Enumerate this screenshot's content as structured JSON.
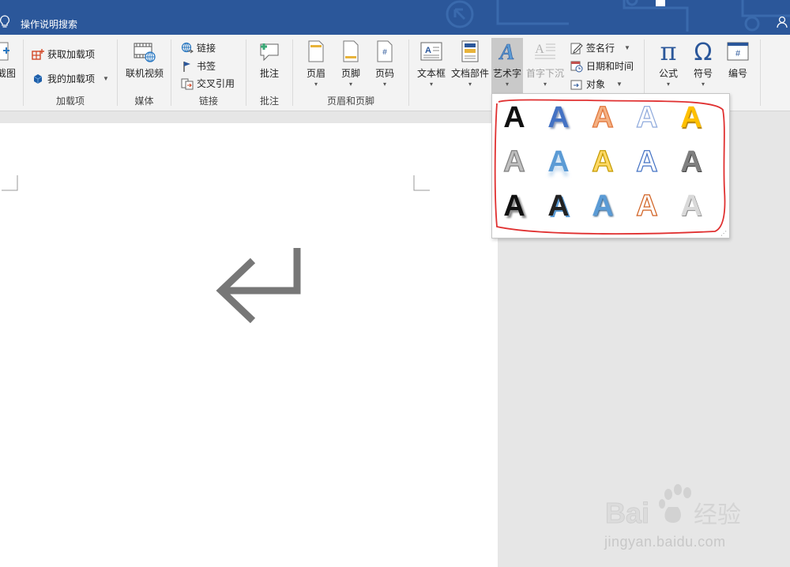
{
  "titlebar": {
    "search_label": "操作说明搜索",
    "accent_color": "#2b579a"
  },
  "ribbon": {
    "partial_screenshot_label": "截图",
    "addins": {
      "get_addins": "获取加载项",
      "my_addins": "我的加载项",
      "group_label": "加载项"
    },
    "media": {
      "online_video": "联机视频",
      "group_label": "媒体"
    },
    "links": {
      "link": "链接",
      "bookmark": "书签",
      "cross_reference": "交叉引用",
      "group_label": "链接"
    },
    "comments": {
      "comment": "批注",
      "group_label": "批注"
    },
    "header_footer": {
      "header": "页眉",
      "footer": "页脚",
      "page_number": "页码",
      "group_label": "页眉和页脚"
    },
    "text": {
      "text_box": "文本框",
      "quick_parts": "文档部件",
      "wordart": "艺术字",
      "drop_cap": "首字下沉",
      "signature_line": "签名行",
      "date_time": "日期和时间",
      "object": "对象"
    },
    "symbols": {
      "equation": "公式",
      "symbol": "符号",
      "number": "编号"
    }
  },
  "wordart_gallery": {
    "styles": [
      {
        "glyph": "A",
        "color": "#111111",
        "style": "plain-black"
      },
      {
        "glyph": "A",
        "color": "#4472c4",
        "style": "blue-shadow"
      },
      {
        "glyph": "A",
        "color": "#f4b183",
        "style": "orange-outline"
      },
      {
        "glyph": "A",
        "color": "#ffffff",
        "style": "blue-outline"
      },
      {
        "glyph": "A",
        "color": "#ffc000",
        "style": "gold"
      },
      {
        "glyph": "A",
        "color": "#bfbfbf",
        "style": "gray-outline"
      },
      {
        "glyph": "A",
        "color": "#5b9bd5",
        "style": "blue-reflection"
      },
      {
        "glyph": "A",
        "color": "#ffd966",
        "style": "yellow-outline"
      },
      {
        "glyph": "A",
        "color": "#ffffff",
        "style": "blue-outline-light"
      },
      {
        "glyph": "A",
        "color": "#7f7f7f",
        "style": "gray-bevel"
      },
      {
        "glyph": "A",
        "color": "#111111",
        "style": "black-shadow"
      },
      {
        "glyph": "A",
        "color": "#222222",
        "style": "dark-gray-shadow"
      },
      {
        "glyph": "A",
        "color": "#5b9bd5",
        "style": "blue-gradient"
      },
      {
        "glyph": "A",
        "color": "#ffffff",
        "style": "orange-outline-white"
      },
      {
        "glyph": "A",
        "color": "#d9d9d9",
        "style": "silver"
      }
    ],
    "highlight_color": "#e03030"
  },
  "document": {
    "paragraph_mark": "↵"
  },
  "watermark": {
    "brand": "Bai du 经验",
    "url": "jingyan.baidu.com"
  }
}
